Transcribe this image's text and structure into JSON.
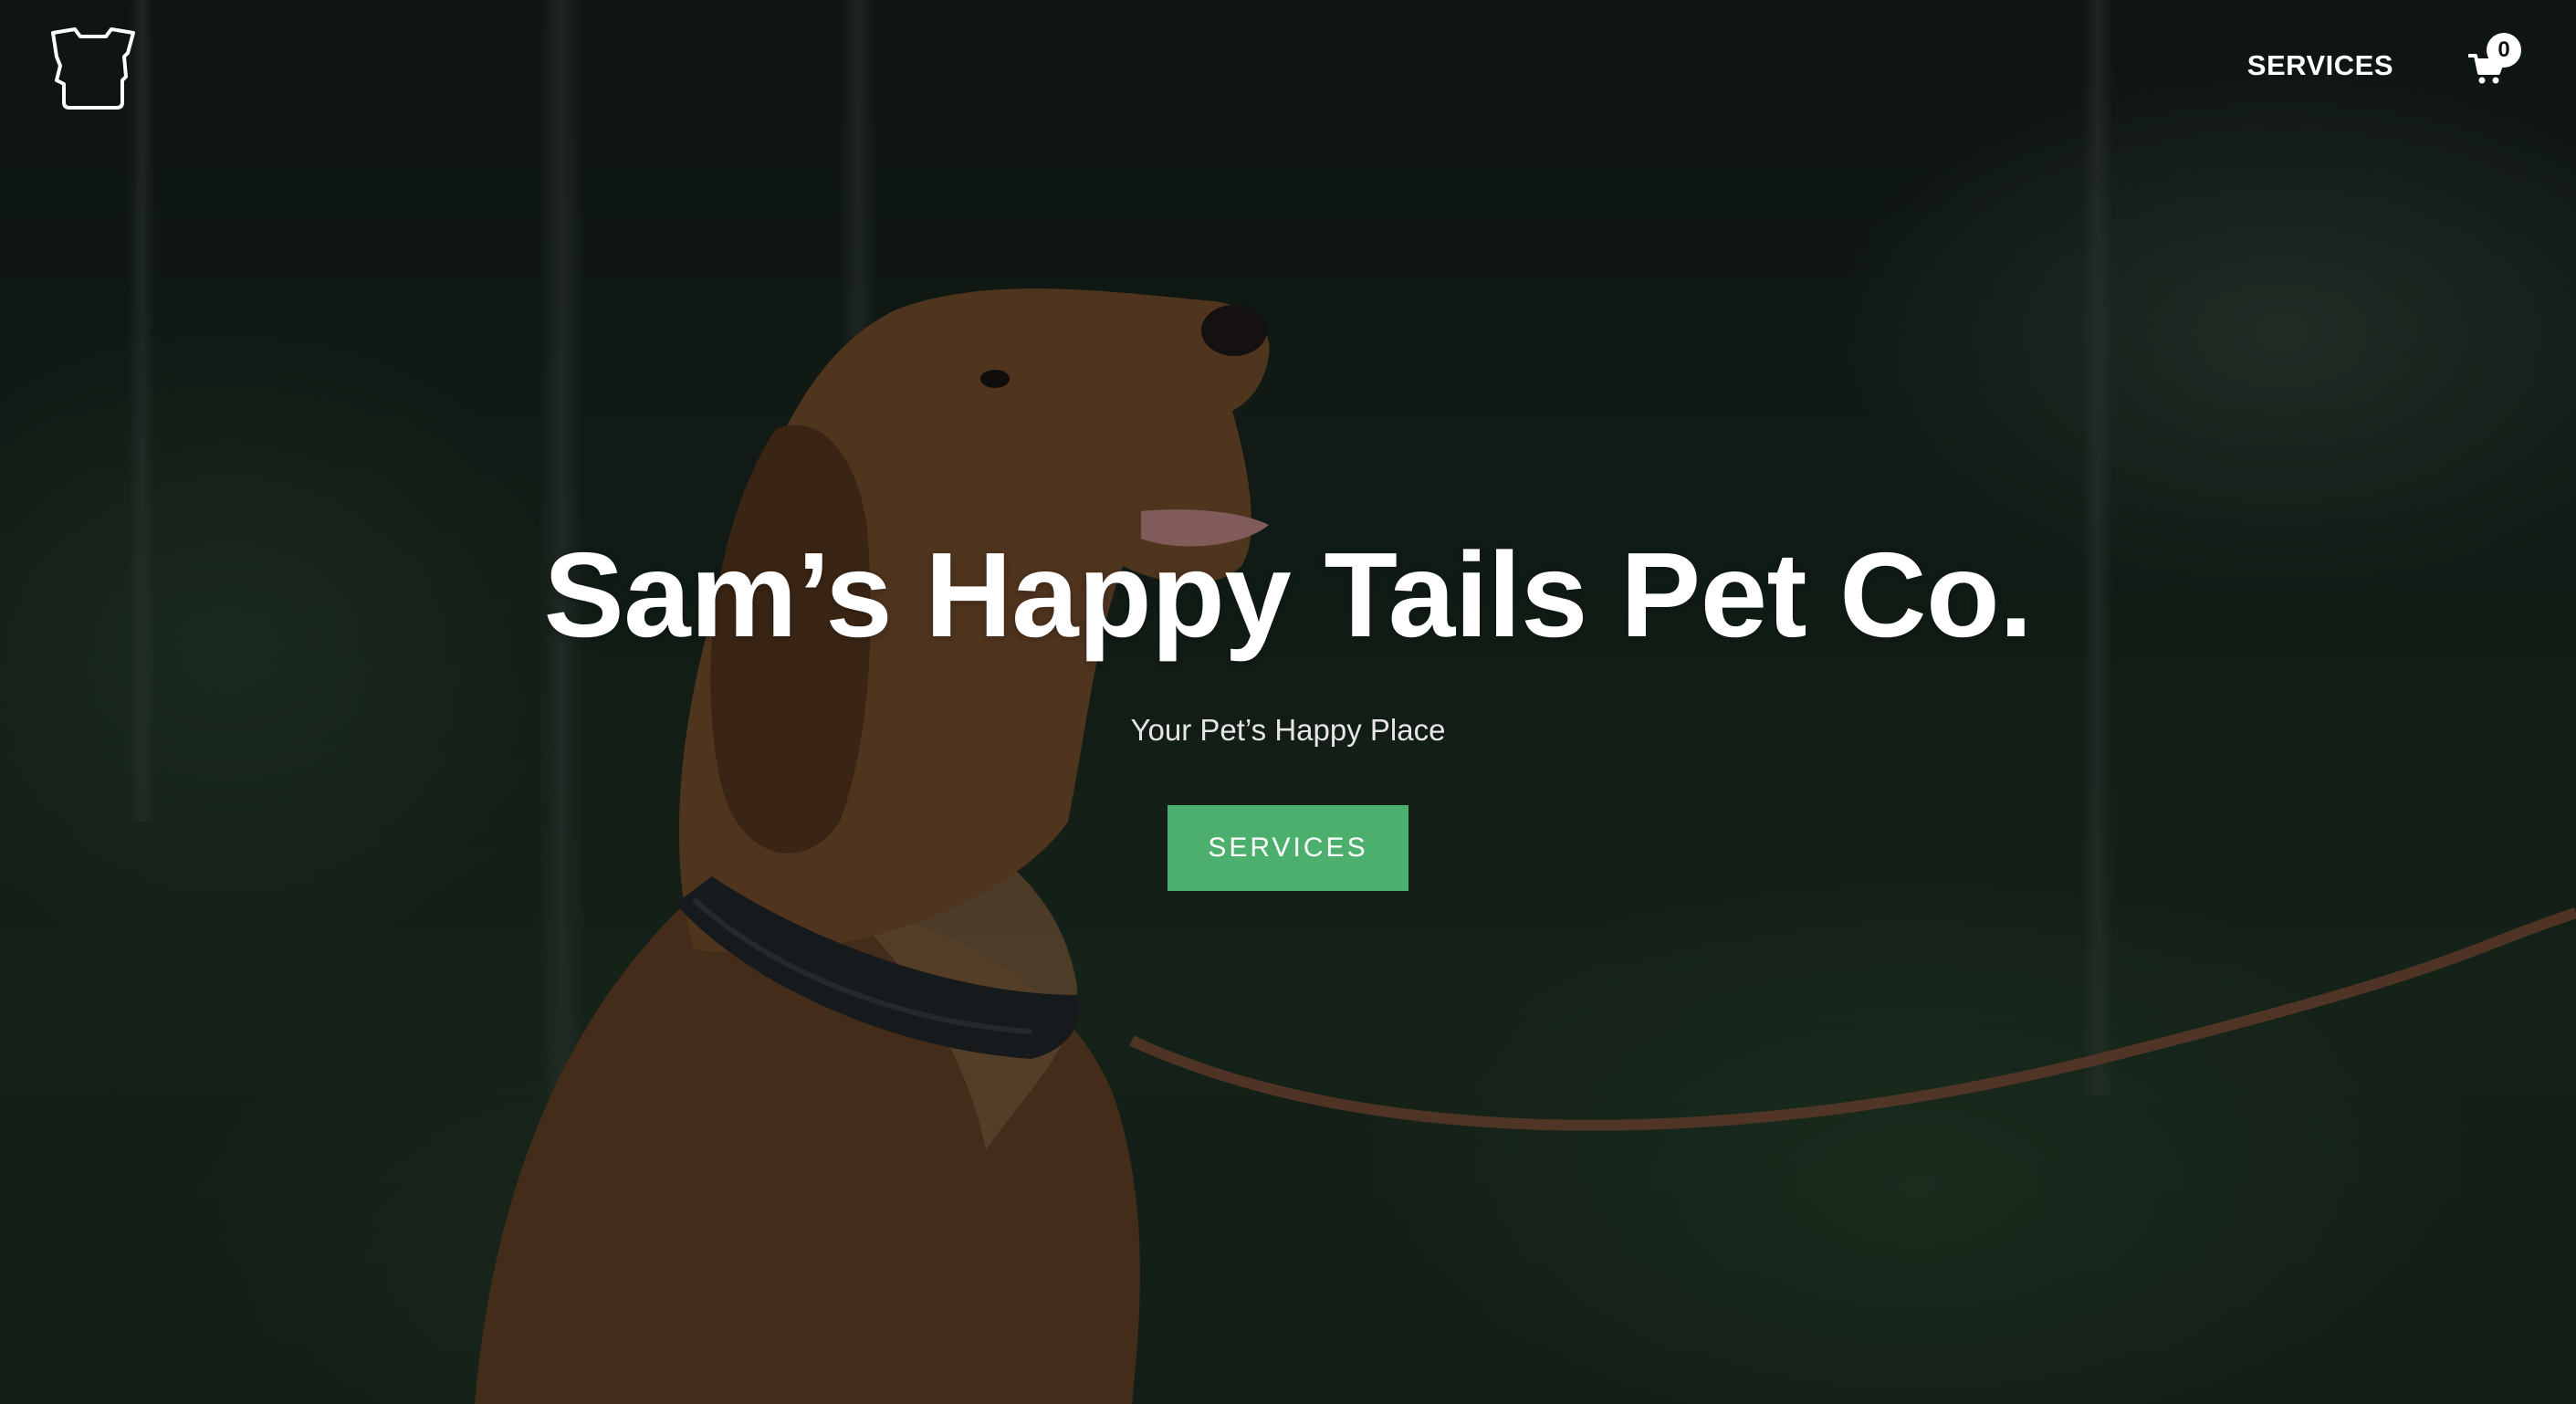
{
  "header": {
    "logo_icon": "dog-head-outline-icon",
    "nav": {
      "services_label": "SERVICES"
    },
    "cart": {
      "icon": "shopping-cart-icon",
      "count": "0"
    }
  },
  "hero": {
    "title": "Sam’s Happy Tails Pet Co.",
    "subtitle": "Your Pet’s Happy Place",
    "button_label": "SERVICES",
    "button_color": "#4caf6d"
  }
}
